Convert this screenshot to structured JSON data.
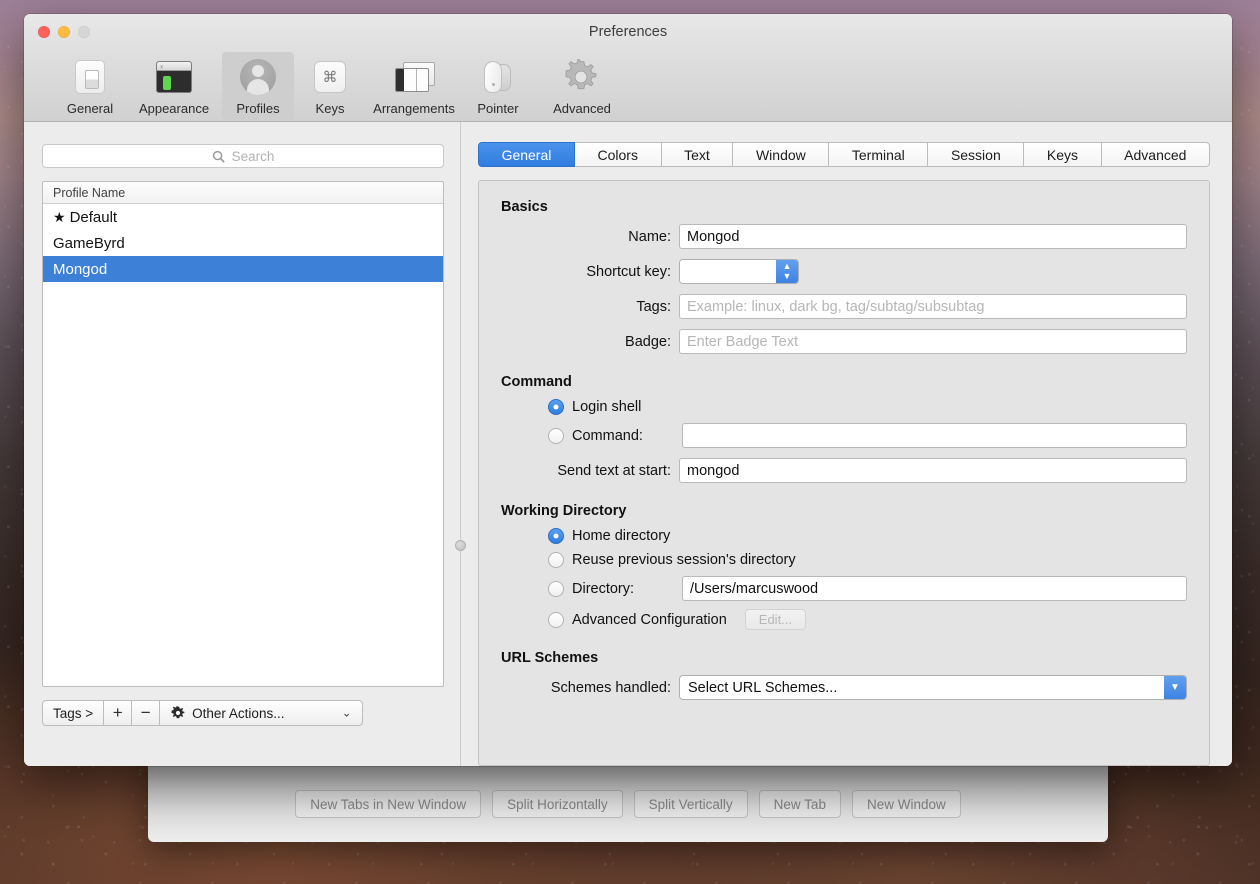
{
  "window": {
    "title": "Preferences",
    "traffic_lights": [
      "close",
      "minimize",
      "zoom"
    ]
  },
  "toolbar": {
    "items": [
      {
        "label": "General",
        "icon": "display-toggle-icon",
        "selected": false
      },
      {
        "label": "Appearance",
        "icon": "terminal-window-icon",
        "selected": false
      },
      {
        "label": "Profiles",
        "icon": "person-silhouette-icon",
        "selected": true
      },
      {
        "label": "Keys",
        "icon": "command-key-icon",
        "selected": false
      },
      {
        "label": "Arrangements",
        "icon": "stacked-windows-icon",
        "selected": false
      },
      {
        "label": "Pointer",
        "icon": "mouse-icon",
        "selected": false
      },
      {
        "label": "Advanced",
        "icon": "gear-icon",
        "selected": false
      }
    ]
  },
  "sidebar": {
    "search": {
      "placeholder": "Search",
      "value": "",
      "icon": "search-icon"
    },
    "list": {
      "header": "Profile Name",
      "rows": [
        {
          "name": "Default",
          "starred": true,
          "star": "★",
          "selected": false
        },
        {
          "name": "GameByrd",
          "starred": false,
          "star": "",
          "selected": false
        },
        {
          "name": "Mongod",
          "starred": false,
          "star": "",
          "selected": true
        }
      ]
    },
    "toolbar": {
      "tags_label": "Tags >",
      "add_label": "+",
      "remove_label": "−",
      "other_actions_label": "Other Actions...",
      "other_actions_icon": "gear-icon",
      "chevron": "⌄"
    }
  },
  "tabs": [
    {
      "label": "General",
      "active": true
    },
    {
      "label": "Colors",
      "active": false
    },
    {
      "label": "Text",
      "active": false
    },
    {
      "label": "Window",
      "active": false
    },
    {
      "label": "Terminal",
      "active": false
    },
    {
      "label": "Session",
      "active": false
    },
    {
      "label": "Keys",
      "active": false
    },
    {
      "label": "Advanced",
      "active": false
    }
  ],
  "general_tab": {
    "basics": {
      "title": "Basics",
      "name_label": "Name:",
      "name_value": "Mongod",
      "shortcut_label": "Shortcut key:",
      "shortcut_value": "",
      "tags_label": "Tags:",
      "tags_value": "",
      "tags_placeholder": "Example: linux, dark bg, tag/subtag/subsubtag",
      "badge_label": "Badge:",
      "badge_value": "",
      "badge_placeholder": "Enter Badge Text"
    },
    "command": {
      "title": "Command",
      "login_shell_label": "Login shell",
      "login_shell_selected": true,
      "command_label": "Command:",
      "command_selected": false,
      "command_value": "",
      "send_text_label": "Send text at start:",
      "send_text_value": "mongod"
    },
    "working_directory": {
      "title": "Working Directory",
      "home_label": "Home directory",
      "home_selected": true,
      "reuse_label": "Reuse previous session's directory",
      "reuse_selected": false,
      "directory_label": "Directory:",
      "directory_selected": false,
      "directory_value": "/Users/marcuswood",
      "advanced_label": "Advanced Configuration",
      "advanced_selected": false,
      "edit_button_label": "Edit..."
    },
    "url_schemes": {
      "title": "URL Schemes",
      "schemes_label": "Schemes handled:",
      "schemes_value": "Select URL Schemes...",
      "chevron": "⌄"
    }
  },
  "background_window": {
    "buttons": [
      "New Tabs in New Window",
      "Split Horizontally",
      "Split Vertically",
      "New Tab",
      "New Window"
    ]
  },
  "colors": {
    "accent_blue": "#3c80d8",
    "tab_active_blue": "#2f7ce0",
    "selection_blue": "#3c80d8",
    "panel_bg": "#e4e4e4",
    "window_bg": "#ececec"
  }
}
